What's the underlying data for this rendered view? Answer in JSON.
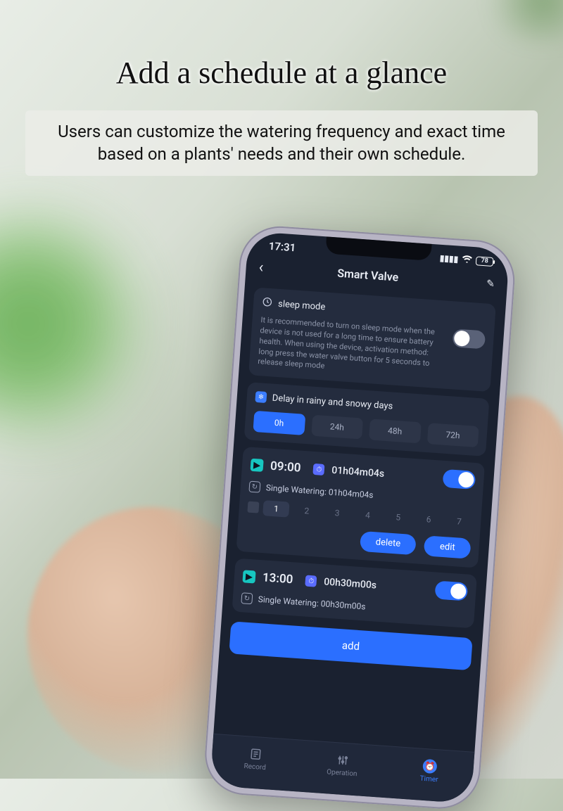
{
  "promo": {
    "headline": "Add a schedule at a glance",
    "subtext": "Users can customize the watering frequency and exact time based on a plants' needs and their own schedule."
  },
  "status": {
    "time": "17:31",
    "battery": "78"
  },
  "header": {
    "title": "Smart Valve"
  },
  "sleep": {
    "label": "sleep mode",
    "desc": "It is recommended to turn on sleep mode when the device is not used for a long time to ensure battery health. When using the device, activation method: long press the water valve button for 5 seconds to release sleep mode",
    "on": false
  },
  "delay": {
    "title": "Delay in rainy and snowy days",
    "options": [
      "0h",
      "24h",
      "48h",
      "72h"
    ],
    "active": 0
  },
  "schedules": [
    {
      "time": "09:00",
      "duration": "01h04m04s",
      "mode_label": "Single Watering: 01h04m04s",
      "enabled": true,
      "days": [
        "1",
        "2",
        "3",
        "4",
        "5",
        "6",
        "7"
      ],
      "active_day": 0,
      "buttons": {
        "delete": "delete",
        "edit": "edit"
      }
    },
    {
      "time": "13:00",
      "duration": "00h30m00s",
      "mode_label": "Single Watering: 00h30m00s",
      "enabled": true
    }
  ],
  "add_label": "add",
  "tabs": [
    {
      "label": "Record"
    },
    {
      "label": "Operation"
    },
    {
      "label": "Timer"
    }
  ],
  "active_tab": 2
}
